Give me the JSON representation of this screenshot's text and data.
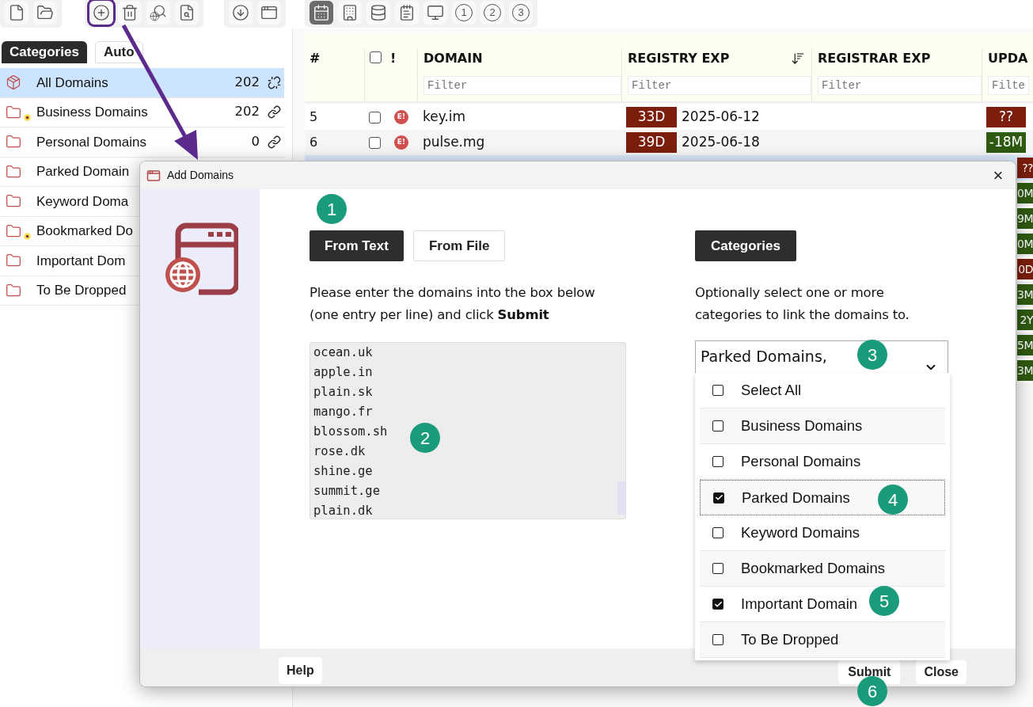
{
  "toolbar": {
    "groups": [
      {
        "buttons": [
          {
            "selected": false
          },
          {
            "selected": false
          }
        ]
      },
      {
        "buttons": [
          {
            "selected": false,
            "highlighted": true
          },
          {
            "selected": false
          },
          {
            "selected": false
          },
          {
            "selected": false
          }
        ]
      },
      {
        "buttons": [
          {
            "selected": false
          },
          {
            "selected": false
          }
        ]
      },
      {
        "buttons": [
          {
            "selected": true
          },
          {
            "selected": false
          },
          {
            "selected": false
          },
          {
            "selected": false
          },
          {
            "selected": false
          },
          {
            "text": "1",
            "selected": false
          },
          {
            "text": "2",
            "selected": false
          },
          {
            "text": "3",
            "selected": false
          }
        ]
      }
    ]
  },
  "sidebar": {
    "tabs": [
      {
        "label": "Categories",
        "selected": true
      },
      {
        "label": "Auto",
        "selected": false
      }
    ],
    "items": [
      {
        "label": "All Domains",
        "kind": "all",
        "dot": false,
        "count": "202",
        "linked": false,
        "selected": true
      },
      {
        "label": "Business Domains",
        "kind": "category",
        "dot": true,
        "count": "202",
        "linked": true,
        "selected": false
      },
      {
        "label": "Personal Domains",
        "kind": "category",
        "dot": false,
        "count": "0",
        "linked": true,
        "selected": false
      },
      {
        "label": "Parked Domain",
        "kind": "category",
        "dot": false,
        "selected": false
      },
      {
        "label": "Keyword Doma",
        "kind": "category",
        "dot": false,
        "selected": false
      },
      {
        "label": "Bookmarked Do",
        "kind": "category",
        "dot": true,
        "selected": false
      },
      {
        "label": "Important Dom",
        "kind": "category",
        "dot": false,
        "selected": false
      },
      {
        "label": "To Be Dropped",
        "kind": "category",
        "dot": false,
        "selected": false
      }
    ]
  },
  "table": {
    "columns": [
      {
        "label": "#"
      },
      {
        "label": "!"
      },
      {
        "label": "DOMAIN",
        "placeholder": "Filter"
      },
      {
        "label": "REGISTRY EXP",
        "placeholder": "Filter",
        "sorted": true
      },
      {
        "label": "REGISTRAR EXP",
        "placeholder": "Filter"
      },
      {
        "label": "UPDA",
        "placeholder": "Filte"
      }
    ],
    "header_checked": false,
    "rows": [
      {
        "number": "5",
        "checked": false,
        "flag": "E!",
        "domain": "key.im",
        "registry_badge": {
          "text": "33D",
          "color": "#7b1e0c"
        },
        "registry_date": "2025-06-12",
        "update": {
          "text": "??",
          "color": "#7b1e0c"
        },
        "selected": false
      },
      {
        "number": "6",
        "checked": false,
        "flag": "E!",
        "domain": "pulse.mg",
        "registry_badge": {
          "text": "39D",
          "color": "#7b1e0c"
        },
        "registry_date": "2025-06-18",
        "update": {
          "text": "-18M",
          "color": "#2f5a12"
        },
        "selected": false
      },
      {
        "update": {
          "text": "??",
          "color": "#7b1e0c"
        },
        "selected": true
      },
      {
        "update": {
          "text": "0M",
          "color": "#2f5a12"
        },
        "selected": false
      },
      {
        "update": {
          "text": "9M",
          "color": "#2f5a12"
        },
        "selected": false
      },
      {
        "update": {
          "text": "0M",
          "color": "#2f5a12"
        },
        "selected": false
      },
      {
        "update": {
          "text": "0D",
          "color": "#7b1e0c"
        },
        "selected": false
      },
      {
        "update": {
          "text": "3M",
          "color": "#2f5a12"
        },
        "selected": false
      },
      {
        "update": {
          "text": "2Y",
          "color": "#2f5a12"
        },
        "selected": false
      },
      {
        "update": {
          "text": "5M",
          "color": "#2f5a12"
        },
        "selected": false
      },
      {
        "update": {
          "text": "3M",
          "color": "#2f5a12"
        },
        "selected": false
      }
    ]
  },
  "dialog": {
    "title": "Add Domains",
    "close": "×",
    "source_tabs": [
      {
        "label": "From Text",
        "selected": true
      },
      {
        "label": "From File",
        "selected": false
      }
    ],
    "instructions": "Please enter the domains into the box below (one entry per line) and click **Submit**",
    "domains": [
      "ocean.uk",
      "apple.in",
      "plain.sk",
      "mango.fr",
      "blossom.sh",
      "rose.dk",
      "shine.ge",
      "summit.ge",
      "plain.dk"
    ],
    "categories_button": "Categories",
    "categories_hint": "Optionally select one or more categories to link the domains to.",
    "select_value": "Parked Domains,",
    "options": [
      {
        "label": "Select All",
        "checked": false,
        "focused": false
      },
      {
        "label": "Business Domains",
        "checked": false,
        "focused": false
      },
      {
        "label": "Personal Domains",
        "checked": false,
        "focused": false
      },
      {
        "label": "Parked Domains",
        "checked": true,
        "focused": true
      },
      {
        "label": "Keyword Domains",
        "checked": false,
        "focused": false
      },
      {
        "label": "Bookmarked Domains",
        "checked": false,
        "focused": false
      },
      {
        "label": "Important Domain",
        "checked": true,
        "focused": false
      },
      {
        "label": "To Be Dropped",
        "checked": false,
        "focused": false
      }
    ],
    "footer": {
      "help": "Help",
      "submit": "Submit",
      "close": "Close"
    }
  },
  "callouts": [
    "1",
    "2",
    "3",
    "4",
    "5",
    "6"
  ]
}
